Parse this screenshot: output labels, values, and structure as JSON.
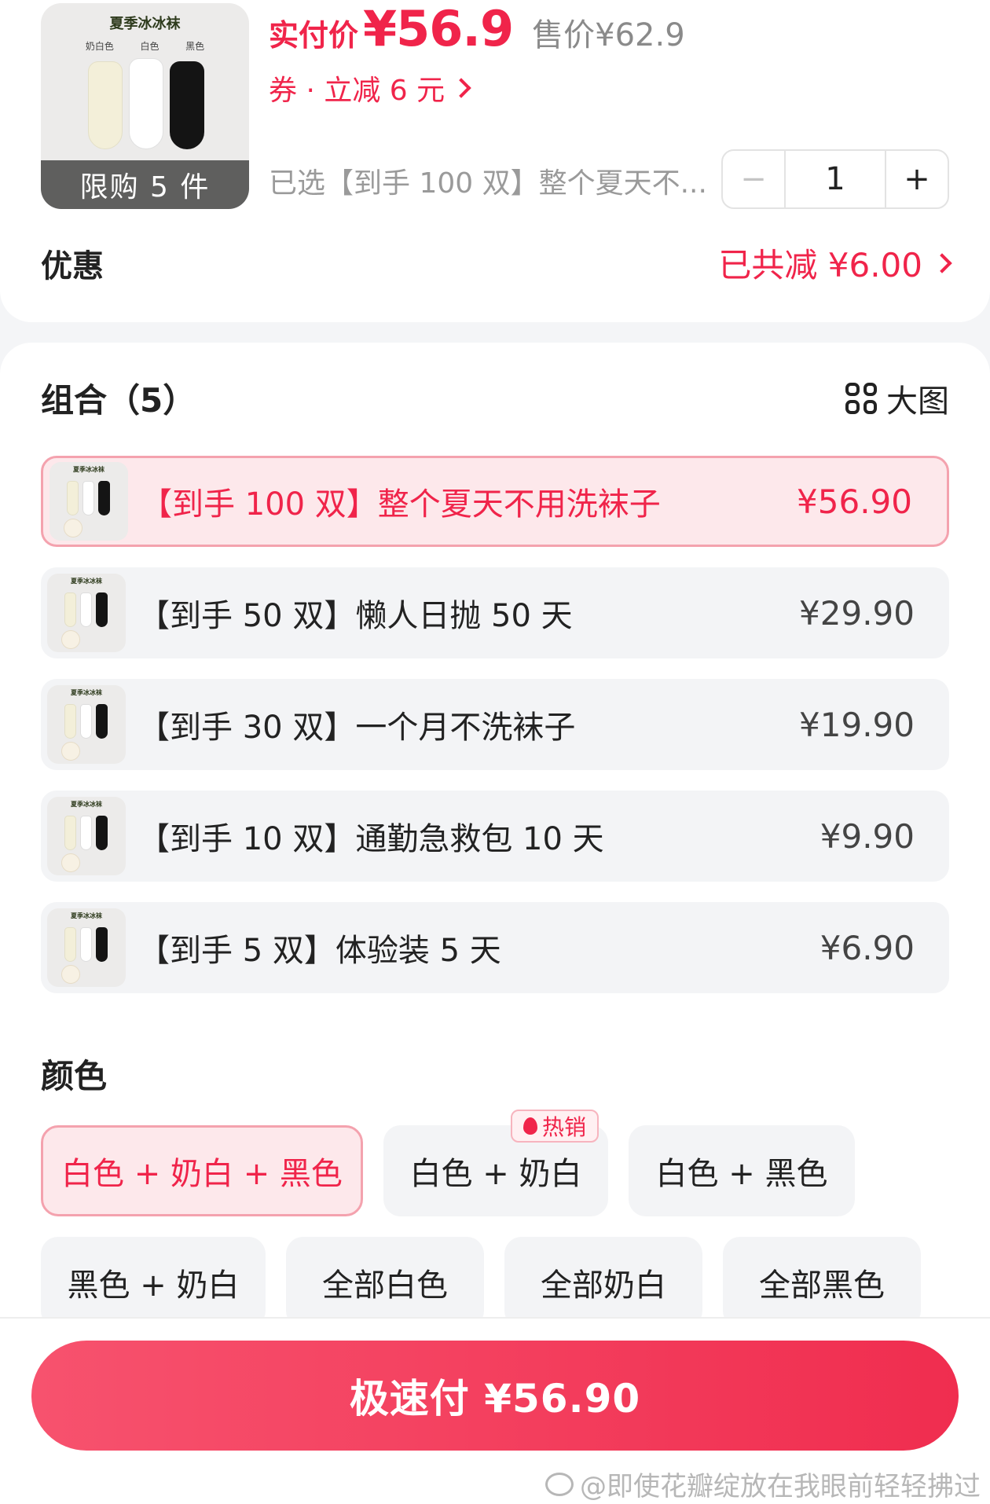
{
  "product": {
    "image_title": "夏季冰冰袜",
    "image_labels": [
      "奶白色",
      "白色",
      "黑色"
    ],
    "limit_text": "限购 5 件",
    "pay_label": "实付价",
    "pay_price": "¥56.9",
    "original_price": "售价¥62.9",
    "coupon_text": "券 · 立减 6 元",
    "selected_text": "已选【到手 100 双】整个夏天不...",
    "quantity": "1",
    "minus": "−",
    "plus": "+"
  },
  "discount": {
    "label": "优惠",
    "value": "已共减 ¥6.00"
  },
  "combos": {
    "title": "组合（5）",
    "big_view_label": "大图",
    "items": [
      {
        "name": "【到手 100 双】整个夏天不用洗袜子",
        "price": "¥56.90",
        "selected": true
      },
      {
        "name": "【到手 50 双】懒人日抛 50 天",
        "price": "¥29.90",
        "selected": false
      },
      {
        "name": "【到手 30 双】一个月不洗袜子",
        "price": "¥19.90",
        "selected": false
      },
      {
        "name": "【到手 10 双】通勤急救包 10 天",
        "price": "¥9.90",
        "selected": false
      },
      {
        "name": "【到手 5 双】体验装 5 天",
        "price": "¥6.90",
        "selected": false
      }
    ]
  },
  "colors": {
    "title": "颜色",
    "hot_tag": "热销",
    "options": [
      {
        "label": "白色 + 奶白 + 黑色",
        "selected": true
      },
      {
        "label": "白色 + 奶白",
        "selected": false
      },
      {
        "label": "白色 + 黑色",
        "selected": false
      },
      {
        "label": "黑色 + 奶白",
        "selected": false
      },
      {
        "label": "全部白色",
        "selected": false
      },
      {
        "label": "全部奶白",
        "selected": false
      },
      {
        "label": "全部黑色",
        "selected": false
      }
    ]
  },
  "pay_button": "极速付 ¥56.90",
  "watermark": "@即使花瓣绽放在我眼前轻轻拂过",
  "theme": {
    "accent": "#f0244a",
    "accent_light": "#fde8eb"
  }
}
